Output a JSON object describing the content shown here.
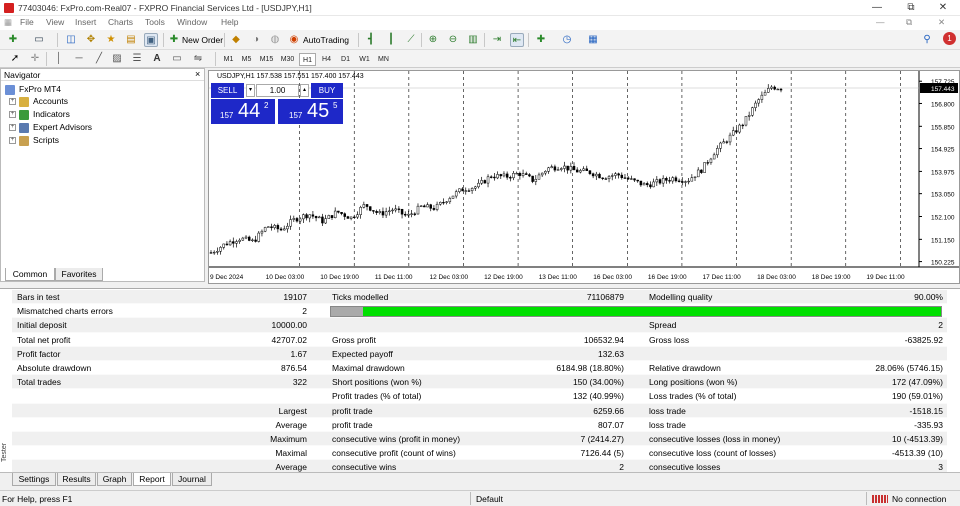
{
  "window": {
    "title": "77403046: FxPro.com-Real07 - FXPRO Financial Services Ltd - [USDJPY,H1]",
    "minimize": "—",
    "restore": "⧉",
    "close": "✕"
  },
  "menu": [
    "File",
    "View",
    "Insert",
    "Charts",
    "Tools",
    "Window",
    "Help"
  ],
  "toolbar": {
    "new_order": "New Order",
    "autotrading": "AutoTrading",
    "notify_count": "1"
  },
  "timeframes": [
    "M1",
    "M5",
    "M15",
    "M30",
    "H1",
    "H4",
    "D1",
    "W1",
    "MN"
  ],
  "active_timeframe": "H1",
  "navigator": {
    "title": "Navigator",
    "close": "×",
    "root": "FxPro MT4",
    "items": [
      "Accounts",
      "Indicators",
      "Expert Advisors",
      "Scripts"
    ],
    "tabs": [
      "Common",
      "Favorites"
    ]
  },
  "chart_header": {
    "text": "USDJPY,H1  157.538 157.551 157.400 157.443"
  },
  "trade_panel": {
    "sell": "SELL",
    "buy": "BUY",
    "lot": "1.00",
    "sell_prefix": "157",
    "sell_big": "44",
    "sell_sup": "2",
    "buy_prefix": "157",
    "buy_big": "45",
    "buy_sup": "5"
  },
  "chart_data": {
    "type": "candlestick",
    "symbol": "USDJPY",
    "timeframe": "H1",
    "current_price": "157.443",
    "y_ticks": [
      "157.725",
      "156.800",
      "155.850",
      "154.925",
      "153.975",
      "153.050",
      "152.100",
      "151.150",
      "150.225"
    ],
    "x_ticks": [
      "9 Dec 2024",
      "10 Dec 03:00",
      "10 Dec 19:00",
      "11 Dec 11:00",
      "12 Dec 03:00",
      "12 Dec 19:00",
      "13 Dec 11:00",
      "16 Dec 03:00",
      "16 Dec 19:00",
      "17 Dec 11:00",
      "18 Dec 03:00",
      "18 Dec 19:00",
      "19 Dec 11:00"
    ],
    "ylim": [
      150.0,
      158.15
    ],
    "close_path": [
      [
        0,
        150.6
      ],
      [
        3,
        150.95
      ],
      [
        6,
        151.2
      ],
      [
        9,
        151.05
      ],
      [
        12,
        151.7
      ],
      [
        15,
        151.55
      ],
      [
        18,
        152.0
      ],
      [
        21,
        152.2
      ],
      [
        24,
        151.9
      ],
      [
        27,
        152.3
      ],
      [
        30,
        152.05
      ],
      [
        33,
        152.6
      ],
      [
        36,
        152.2
      ],
      [
        39,
        152.4
      ],
      [
        42,
        152.1
      ],
      [
        45,
        152.5
      ],
      [
        48,
        152.45
      ],
      [
        51,
        152.9
      ],
      [
        54,
        153.25
      ],
      [
        57,
        153.35
      ],
      [
        60,
        153.8
      ],
      [
        63,
        153.75
      ],
      [
        66,
        153.9
      ],
      [
        69,
        153.6
      ],
      [
        72,
        154.1
      ],
      [
        75,
        154.2
      ],
      [
        78,
        154.0
      ],
      [
        81,
        153.95
      ],
      [
        84,
        153.75
      ],
      [
        87,
        153.85
      ],
      [
        90,
        153.6
      ],
      [
        93,
        153.4
      ],
      [
        96,
        153.55
      ],
      [
        99,
        153.7
      ],
      [
        102,
        153.6
      ],
      [
        105,
        154.05
      ],
      [
        108,
        154.85
      ],
      [
        111,
        155.4
      ],
      [
        114,
        156.0
      ],
      [
        117,
        156.9
      ],
      [
        120,
        157.5
      ],
      [
        122,
        157.44
      ]
    ]
  },
  "report": {
    "rows": [
      {
        "c1l": "Bars in test",
        "c1v": "19107",
        "c2l": "Ticks modelled",
        "c2v": "71106879",
        "c3l": "Modelling quality",
        "c3v": "90.00%"
      },
      {
        "c1l": "Mismatched charts errors",
        "c1v": "2",
        "bar": true
      },
      {
        "c1l": "Initial deposit",
        "c1v": "10000.00",
        "c3l": "Spread",
        "c3v": "2"
      },
      {
        "c1l": "Total net profit",
        "c1v": "42707.02",
        "c2l": "Gross profit",
        "c2v": "106532.94",
        "c3l": "Gross loss",
        "c3v": "-63825.92"
      },
      {
        "c1l": "Profit factor",
        "c1v": "1.67",
        "c2l": "Expected payoff",
        "c2v": "132.63"
      },
      {
        "c1l": "Absolute drawdown",
        "c1v": "876.54",
        "c2l": "Maximal drawdown",
        "c2v": "6184.98 (18.80%)",
        "c3l": "Relative drawdown",
        "c3v": "28.06% (5746.15)"
      },
      {
        "c1l": "Total trades",
        "c1v": "322",
        "c2l": "Short positions (won %)",
        "c2v": "150 (34.00%)",
        "c3l": "Long positions (won %)",
        "c3v": "172 (47.09%)"
      },
      {
        "c2l": "Profit trades (% of total)",
        "c2v": "132 (40.99%)",
        "c3l": "Loss trades (% of total)",
        "c3v": "190 (59.01%)"
      },
      {
        "c1v": "Largest",
        "c2l": "profit trade",
        "c2v": "6259.66",
        "c3l": "loss trade",
        "c3v": "-1518.15"
      },
      {
        "c1v": "Average",
        "c2l": "profit trade",
        "c2v": "807.07",
        "c3l": "loss trade",
        "c3v": "-335.93"
      },
      {
        "c1v": "Maximum",
        "c2l": "consecutive wins (profit in money)",
        "c2v": "7 (2414.27)",
        "c3l": "consecutive losses (loss in money)",
        "c3v": "10 (-4513.39)"
      },
      {
        "c1v": "Maximal",
        "c2l": "consecutive profit (count of wins)",
        "c2v": "7126.44 (5)",
        "c3l": "consecutive loss (count of losses)",
        "c3v": "-4513.39 (10)"
      },
      {
        "c1v": "Average",
        "c2l": "consecutive wins",
        "c2v": "2",
        "c3l": "consecutive losses",
        "c3v": "3"
      }
    ],
    "modelling_quality_fraction": 0.9
  },
  "bottom_tabs": [
    "Settings",
    "Results",
    "Graph",
    "Report",
    "Journal"
  ],
  "active_bottom_tab": "Report",
  "tester_label": "Tester",
  "status": {
    "help": "For Help, press F1",
    "profile": "Default",
    "connection": "No connection"
  },
  "colors": {
    "chart_fg": "#000000",
    "progress_green": "#00e000",
    "panel_blue": "#1e28c8"
  }
}
